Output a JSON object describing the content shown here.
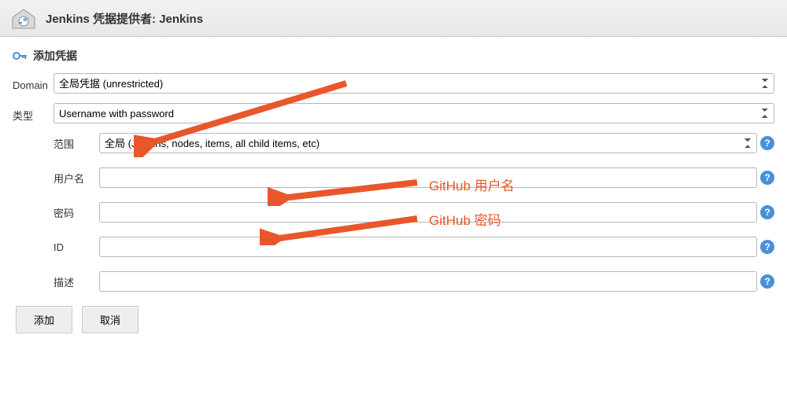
{
  "header": {
    "title": "Jenkins 凭据提供者: Jenkins"
  },
  "section": {
    "title": "添加凭据"
  },
  "form": {
    "domain": {
      "label": "Domain",
      "value": "全局凭据 (unrestricted)"
    },
    "kind": {
      "label": "类型",
      "value": "Username with password"
    },
    "scope": {
      "label": "范围",
      "value": "全局 (Jenkins, nodes, items, all child items, etc)"
    },
    "username": {
      "label": "用户名",
      "value": ""
    },
    "password": {
      "label": "密码",
      "value": ""
    },
    "id": {
      "label": "ID",
      "value": ""
    },
    "description": {
      "label": "描述",
      "value": ""
    }
  },
  "buttons": {
    "add": "添加",
    "cancel": "取消"
  },
  "annotations": {
    "username_hint": "GitHub 用户名",
    "password_hint": "GitHub 密码"
  },
  "help_glyph": "?"
}
